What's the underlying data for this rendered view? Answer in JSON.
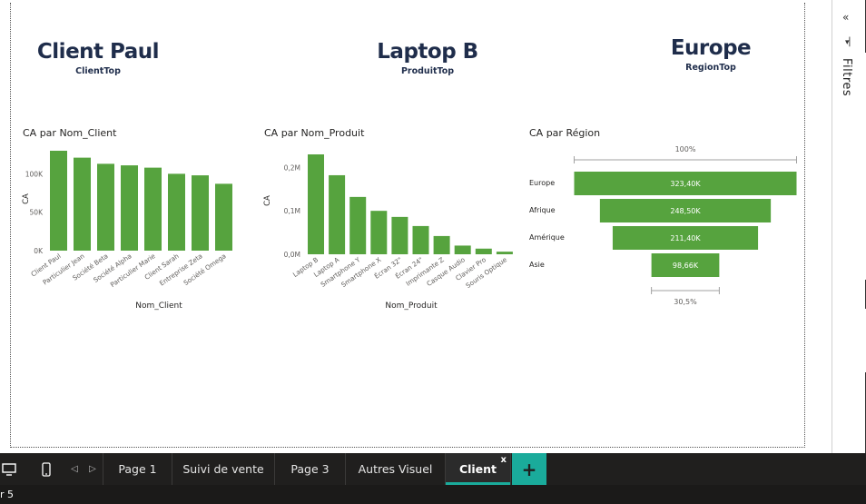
{
  "cards": [
    {
      "value": "Client Paul",
      "label": "ClientTop"
    },
    {
      "value": "Laptop B",
      "label": "ProduitTop"
    },
    {
      "value": "Europe",
      "label": "RegionTop"
    }
  ],
  "charts": {
    "client": {
      "title": "CA par Nom_Client",
      "xlabel": "Nom_Client",
      "ylabel": "CA"
    },
    "produit": {
      "title": "CA par Nom_Produit",
      "xlabel": "Nom_Produit",
      "ylabel": "CA"
    },
    "region": {
      "title": "CA par Région",
      "top_pct": "100%",
      "bottom_pct": "30,5%"
    }
  },
  "chart_data": [
    {
      "type": "bar",
      "title": "CA par Nom_Client",
      "xlabel": "Nom_Client",
      "ylabel": "CA",
      "categories": [
        "Client Paul",
        "Particulier Jean",
        "Société Beta",
        "Société Alpha",
        "Particulier Marie",
        "Client Sarah",
        "Entreprise Zeta",
        "Société Omega"
      ],
      "values": [
        130000,
        121000,
        113000,
        111000,
        108000,
        100000,
        98000,
        87000
      ],
      "yticks": [
        "0K",
        "50K",
        "100K"
      ],
      "ylim": [
        0,
        130000
      ],
      "color": "#56a33e"
    },
    {
      "type": "bar",
      "title": "CA par Nom_Produit",
      "xlabel": "Nom_Produit",
      "ylabel": "CA",
      "categories": [
        "Laptop B",
        "Laptop A",
        "Smartphone Y",
        "Smartphone X",
        "Écran 32\"",
        "Écran 24\"",
        "Imprimante Z",
        "Casque Audio",
        "Clavier Pro",
        "Souris Optique"
      ],
      "values": [
        230000,
        182000,
        132000,
        100000,
        86000,
        65000,
        42000,
        20000,
        13000,
        6000
      ],
      "yticks": [
        "0,0M",
        "0,1M",
        "0,2M"
      ],
      "ylim": [
        0,
        230000
      ],
      "color": "#56a33e"
    },
    {
      "type": "funnel",
      "title": "CA par Région",
      "categories": [
        "Europe",
        "Afrique",
        "Amérique",
        "Asie"
      ],
      "values": [
        323400,
        248500,
        211400,
        98660
      ],
      "value_labels": [
        "323,40K",
        "248,50K",
        "211,40K",
        "98,66K"
      ],
      "top_percent": "100%",
      "bottom_percent": "30,5%",
      "color": "#56a33e"
    }
  ],
  "right_pane": {
    "label": "Filtres"
  },
  "tabs": [
    {
      "label": "Page 1"
    },
    {
      "label": "Suivi de vente"
    },
    {
      "label": "Page 3"
    },
    {
      "label": "Autres Visuel"
    },
    {
      "label": "Client",
      "close": "x"
    }
  ],
  "add_tab": "+",
  "status": {
    "text": "r 5"
  }
}
